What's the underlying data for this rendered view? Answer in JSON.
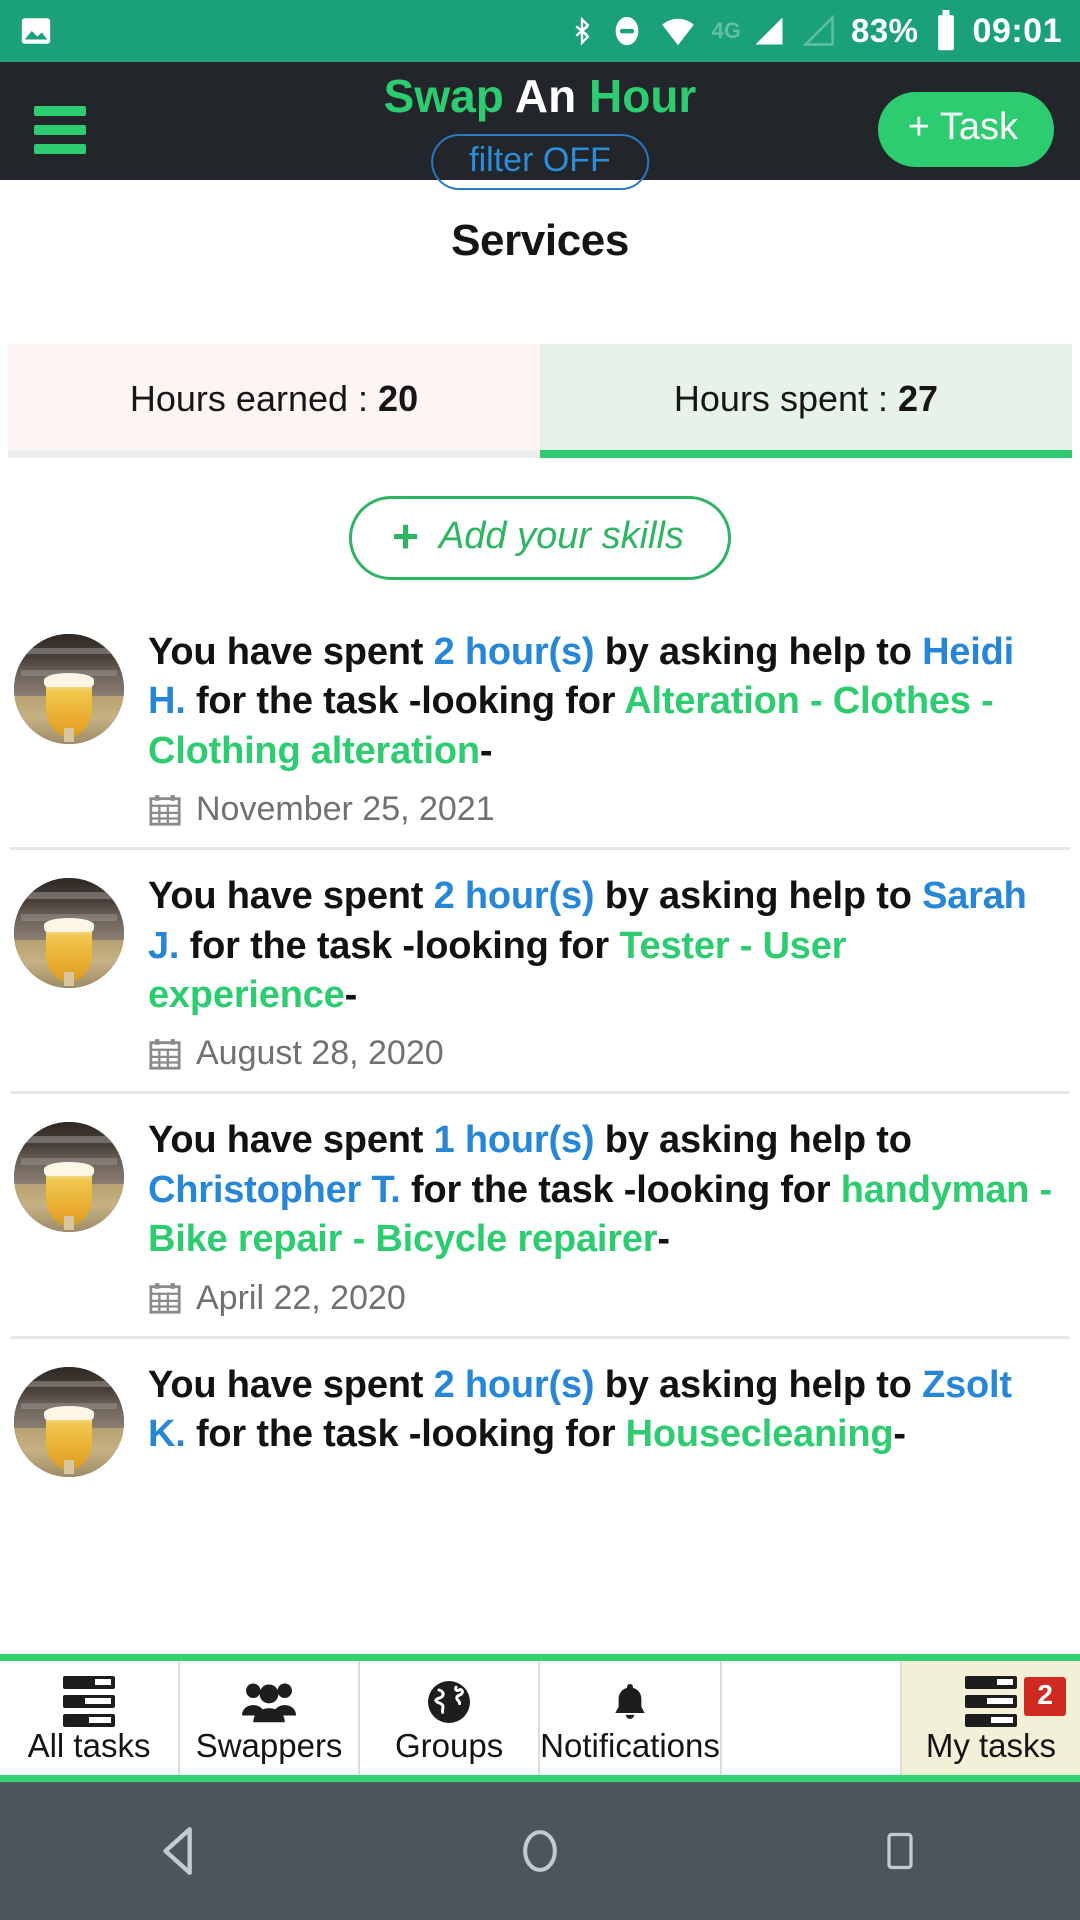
{
  "status_bar": {
    "left_icon": "image-icon",
    "icons": [
      "bluetooth-icon",
      "do-not-disturb-icon",
      "wifi-icon"
    ],
    "network_label": "4G",
    "signal_primary": "signal-full-icon",
    "signal_secondary": "signal-empty-icon",
    "battery_percent": "83%",
    "battery_icon": "battery-icon",
    "clock": "09:01"
  },
  "app_bar": {
    "menu_icon": "hamburger-menu-icon",
    "brand": {
      "word1": "Swap",
      "word2": "An",
      "word3": "Hour"
    },
    "filter_label": "filter OFF",
    "add_task_label": "+ Task"
  },
  "page": {
    "title": "Services"
  },
  "tabs": [
    {
      "label": "Hours earned :",
      "value": "20",
      "active": false
    },
    {
      "label": "Hours spent :",
      "value": "27",
      "active": true
    }
  ],
  "skills_button": {
    "icon": "plus-icon",
    "label": "Add your skills"
  },
  "list": [
    {
      "avatar": "user-avatar-beer-glass",
      "prefix": "You have spent ",
      "hours": "2 hour(s)",
      "middle": " by asking help to ",
      "person": "Heidi H.",
      "connector": " for the task -looking for ",
      "task": "Alteration - Clothes - Clothing alteration",
      "suffix": "-",
      "date_icon": "calendar-icon",
      "date": "November 25, 2021"
    },
    {
      "avatar": "user-avatar-beer-glass",
      "prefix": "You have spent ",
      "hours": "2 hour(s)",
      "middle": " by asking help to ",
      "person": "Sarah J.",
      "connector": " for the task -looking for ",
      "task": "Tester - User experience",
      "suffix": "-",
      "date_icon": "calendar-icon",
      "date": "August 28, 2020"
    },
    {
      "avatar": "user-avatar-beer-glass",
      "prefix": "You have spent ",
      "hours": "1 hour(s)",
      "middle": " by asking help to ",
      "person": "Christopher T.",
      "connector": " for the task -looking for ",
      "task": "handyman - Bike repair - Bicycle repairer",
      "suffix": "-",
      "date_icon": "calendar-icon",
      "date": "April 22, 2020"
    },
    {
      "avatar": "user-avatar-beer-glass",
      "prefix": "You have spent ",
      "hours": "2 hour(s)",
      "middle": " by asking help to ",
      "person": "Zsolt K.",
      "connector": " for the task -looking for ",
      "task": "Housecleaning",
      "suffix": "-",
      "date_icon": "calendar-icon",
      "date": ""
    }
  ],
  "bottom_nav": [
    {
      "label": "All tasks",
      "icon": "list-icon",
      "active": false,
      "badge": ""
    },
    {
      "label": "Swappers",
      "icon": "people-group-icon",
      "active": false,
      "badge": ""
    },
    {
      "label": "Groups",
      "icon": "globe-icon",
      "active": false,
      "badge": ""
    },
    {
      "label": "Notifications",
      "icon": "bell-icon",
      "active": false,
      "badge": ""
    },
    {
      "label": "",
      "icon": "",
      "active": false,
      "badge": ""
    },
    {
      "label": "My tasks",
      "icon": "list-icon",
      "active": true,
      "badge": "2"
    }
  ],
  "android_nav": {
    "back": "back-triangle-icon",
    "home": "home-circle-icon",
    "recents": "recents-square-icon"
  },
  "colors": {
    "status_bar": "#1aa179",
    "app_bar": "#22252a",
    "brand_green": "#2ecc71",
    "link_blue": "#2787d6",
    "task_green": "#2ecc71",
    "tab_active_bg": "#e7f3ea",
    "tab_inactive_bg": "#fdf5f4",
    "nav_active_bg": "#f3f0d8",
    "badge_red": "#cf2a1f",
    "android_nav": "#4c555c"
  }
}
